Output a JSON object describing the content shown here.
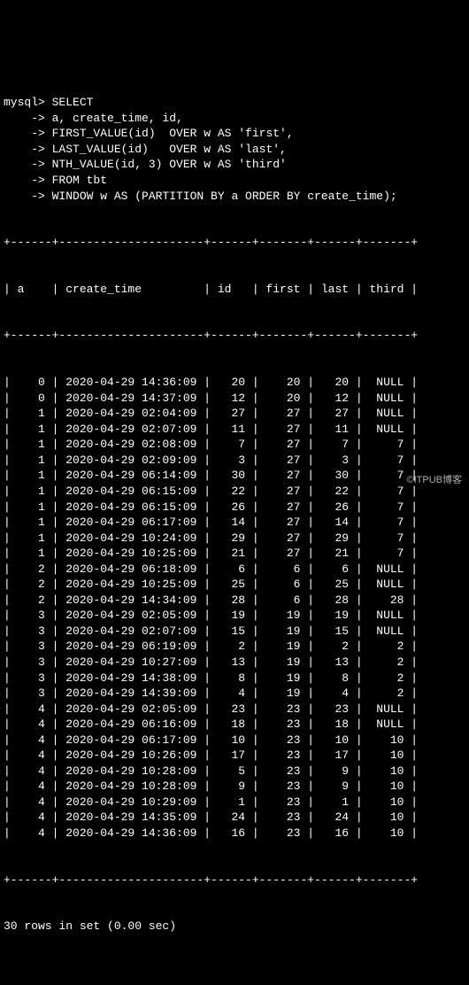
{
  "prompt": "mysql>",
  "query_lines": [
    "SELECT",
    "a, create_time, id,",
    "FIRST_VALUE(id)  OVER w AS 'first',",
    "LAST_VALUE(id)   OVER w AS 'last',",
    "NTH_VALUE(id, 3) OVER w AS 'third'",
    "FROM tbt",
    "WINDOW w AS (PARTITION BY a ORDER BY create_time);"
  ],
  "continuation": "->",
  "columns": [
    "a",
    "create_time",
    "id",
    "first",
    "last",
    "third"
  ],
  "separator": "+------+---------------------+------+-------+------+-------+",
  "rows": [
    {
      "a": "0",
      "create_time": "2020-04-29 14:36:09",
      "id": "20",
      "first": "20",
      "last": "20",
      "third": "NULL"
    },
    {
      "a": "0",
      "create_time": "2020-04-29 14:37:09",
      "id": "12",
      "first": "20",
      "last": "12",
      "third": "NULL"
    },
    {
      "a": "1",
      "create_time": "2020-04-29 02:04:09",
      "id": "27",
      "first": "27",
      "last": "27",
      "third": "NULL"
    },
    {
      "a": "1",
      "create_time": "2020-04-29 02:07:09",
      "id": "11",
      "first": "27",
      "last": "11",
      "third": "NULL"
    },
    {
      "a": "1",
      "create_time": "2020-04-29 02:08:09",
      "id": "7",
      "first": "27",
      "last": "7",
      "third": "7"
    },
    {
      "a": "1",
      "create_time": "2020-04-29 02:09:09",
      "id": "3",
      "first": "27",
      "last": "3",
      "third": "7"
    },
    {
      "a": "1",
      "create_time": "2020-04-29 06:14:09",
      "id": "30",
      "first": "27",
      "last": "30",
      "third": "7"
    },
    {
      "a": "1",
      "create_time": "2020-04-29 06:15:09",
      "id": "22",
      "first": "27",
      "last": "22",
      "third": "7"
    },
    {
      "a": "1",
      "create_time": "2020-04-29 06:15:09",
      "id": "26",
      "first": "27",
      "last": "26",
      "third": "7"
    },
    {
      "a": "1",
      "create_time": "2020-04-29 06:17:09",
      "id": "14",
      "first": "27",
      "last": "14",
      "third": "7"
    },
    {
      "a": "1",
      "create_time": "2020-04-29 10:24:09",
      "id": "29",
      "first": "27",
      "last": "29",
      "third": "7"
    },
    {
      "a": "1",
      "create_time": "2020-04-29 10:25:09",
      "id": "21",
      "first": "27",
      "last": "21",
      "third": "7"
    },
    {
      "a": "2",
      "create_time": "2020-04-29 06:18:09",
      "id": "6",
      "first": "6",
      "last": "6",
      "third": "NULL"
    },
    {
      "a": "2",
      "create_time": "2020-04-29 10:25:09",
      "id": "25",
      "first": "6",
      "last": "25",
      "third": "NULL"
    },
    {
      "a": "2",
      "create_time": "2020-04-29 14:34:09",
      "id": "28",
      "first": "6",
      "last": "28",
      "third": "28"
    },
    {
      "a": "3",
      "create_time": "2020-04-29 02:05:09",
      "id": "19",
      "first": "19",
      "last": "19",
      "third": "NULL"
    },
    {
      "a": "3",
      "create_time": "2020-04-29 02:07:09",
      "id": "15",
      "first": "19",
      "last": "15",
      "third": "NULL"
    },
    {
      "a": "3",
      "create_time": "2020-04-29 06:19:09",
      "id": "2",
      "first": "19",
      "last": "2",
      "third": "2"
    },
    {
      "a": "3",
      "create_time": "2020-04-29 10:27:09",
      "id": "13",
      "first": "19",
      "last": "13",
      "third": "2"
    },
    {
      "a": "3",
      "create_time": "2020-04-29 14:38:09",
      "id": "8",
      "first": "19",
      "last": "8",
      "third": "2"
    },
    {
      "a": "3",
      "create_time": "2020-04-29 14:39:09",
      "id": "4",
      "first": "19",
      "last": "4",
      "third": "2"
    },
    {
      "a": "4",
      "create_time": "2020-04-29 02:05:09",
      "id": "23",
      "first": "23",
      "last": "23",
      "third": "NULL"
    },
    {
      "a": "4",
      "create_time": "2020-04-29 06:16:09",
      "id": "18",
      "first": "23",
      "last": "18",
      "third": "NULL"
    },
    {
      "a": "4",
      "create_time": "2020-04-29 06:17:09",
      "id": "10",
      "first": "23",
      "last": "10",
      "third": "10"
    },
    {
      "a": "4",
      "create_time": "2020-04-29 10:26:09",
      "id": "17",
      "first": "23",
      "last": "17",
      "third": "10"
    },
    {
      "a": "4",
      "create_time": "2020-04-29 10:28:09",
      "id": "5",
      "first": "23",
      "last": "9",
      "third": "10"
    },
    {
      "a": "4",
      "create_time": "2020-04-29 10:28:09",
      "id": "9",
      "first": "23",
      "last": "9",
      "third": "10"
    },
    {
      "a": "4",
      "create_time": "2020-04-29 10:29:09",
      "id": "1",
      "first": "23",
      "last": "1",
      "third": "10"
    },
    {
      "a": "4",
      "create_time": "2020-04-29 14:35:09",
      "id": "24",
      "first": "23",
      "last": "24",
      "third": "10"
    },
    {
      "a": "4",
      "create_time": "2020-04-29 14:36:09",
      "id": "16",
      "first": "23",
      "last": "16",
      "third": "10"
    }
  ],
  "footer": "30 rows in set (0.00 sec)",
  "watermark": "©ITPUB博客"
}
